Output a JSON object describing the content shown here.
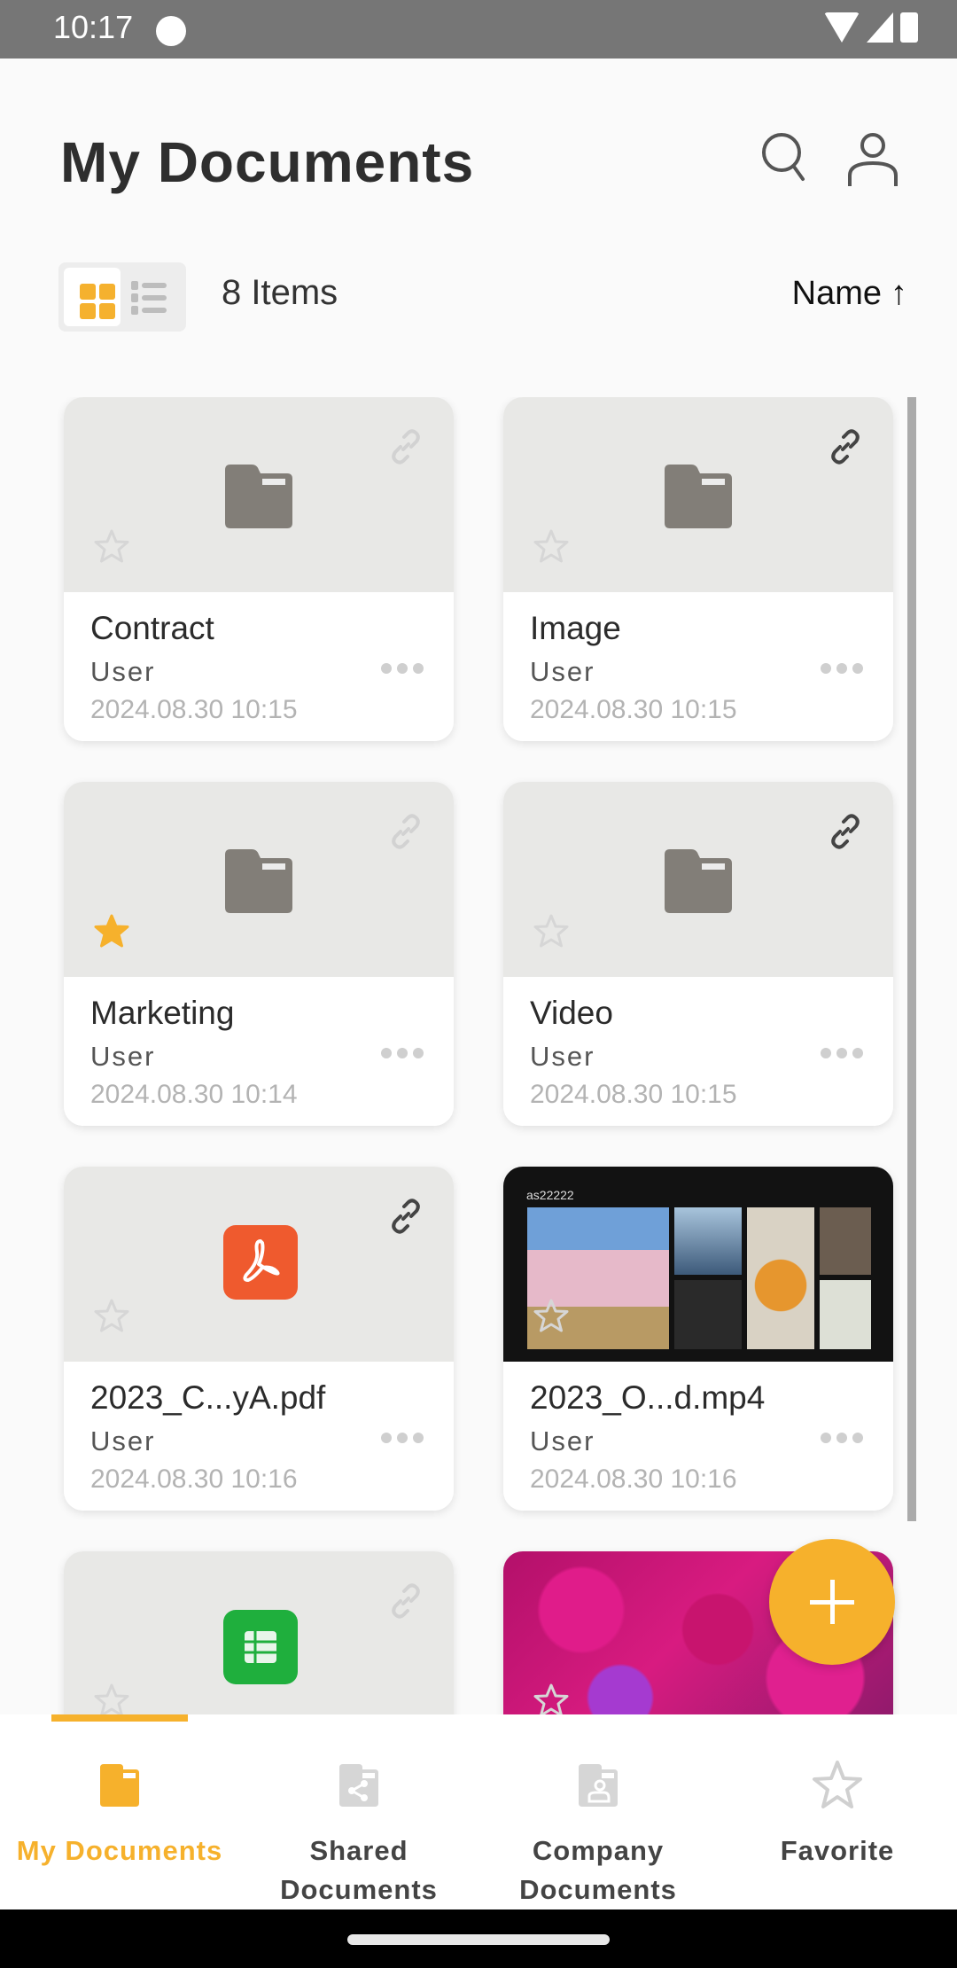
{
  "status_bar": {
    "time": "10:17"
  },
  "header": {
    "title": "My Documents"
  },
  "toolbar": {
    "item_count": "8 Items",
    "sort_label": "Name",
    "sort_direction": "↑",
    "view_mode": "grid"
  },
  "colors": {
    "accent": "#f6b12c",
    "pdf": "#ef5a2e",
    "sheet": "#1faf3d",
    "folder": "#827e78"
  },
  "items": [
    {
      "name": "Contract",
      "owner": "User",
      "date": "2024.08.30 10:15",
      "type": "folder",
      "favorite": false,
      "shared_link": false
    },
    {
      "name": "Image",
      "owner": "User",
      "date": "2024.08.30 10:15",
      "type": "folder",
      "favorite": false,
      "shared_link": true
    },
    {
      "name": "Marketing",
      "owner": "User",
      "date": "2024.08.30 10:14",
      "type": "folder",
      "favorite": true,
      "shared_link": false
    },
    {
      "name": "Video",
      "owner": "User",
      "date": "2024.08.30 10:15",
      "type": "folder",
      "favorite": false,
      "shared_link": true
    },
    {
      "name": "2023_C...yA.pdf",
      "owner": "User",
      "date": "2024.08.30 10:16",
      "type": "pdf",
      "favorite": false,
      "shared_link": true
    },
    {
      "name": "2023_O...d.mp4",
      "owner": "User",
      "date": "2024.08.30 10:16",
      "type": "video",
      "favorite": false,
      "shared_link": false
    },
    {
      "name": "",
      "owner": "",
      "date": "",
      "type": "spreadsheet",
      "favorite": false,
      "shared_link": false
    },
    {
      "name": "",
      "owner": "",
      "date": "",
      "type": "image",
      "favorite": false,
      "shared_link": false
    }
  ],
  "bottom_nav": {
    "items": [
      {
        "label": "My Documents",
        "icon": "folder-icon",
        "active": true
      },
      {
        "label": "Shared\nDocuments",
        "icon": "shared-folder-icon",
        "active": false
      },
      {
        "label": "Company\nDocuments",
        "icon": "company-folder-icon",
        "active": false
      },
      {
        "label": "Favorite",
        "icon": "star-icon",
        "active": false
      }
    ]
  }
}
